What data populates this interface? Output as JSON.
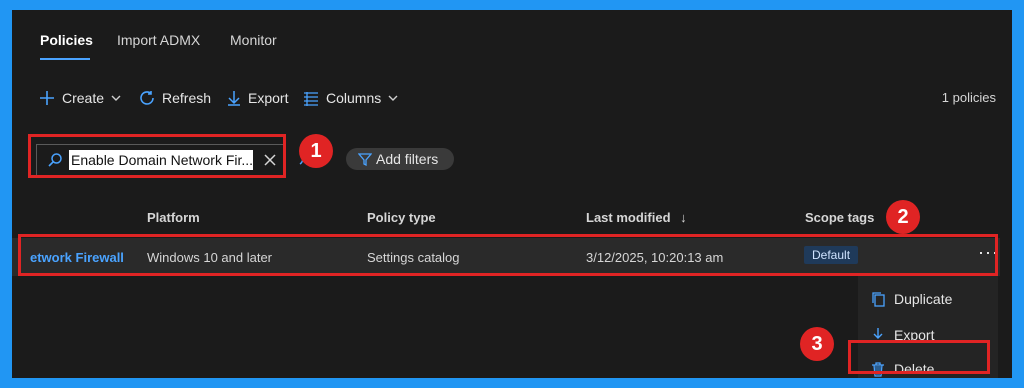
{
  "tabs": [
    {
      "label": "Policies",
      "active": true
    },
    {
      "label": "Import ADMX",
      "active": false
    },
    {
      "label": "Monitor",
      "active": false
    }
  ],
  "toolbar": {
    "create_label": "Create",
    "refresh_label": "Refresh",
    "export_label": "Export",
    "columns_label": "Columns",
    "count_text": "1 policies"
  },
  "search": {
    "value": "Enable Domain Network Fir..."
  },
  "filters": {
    "add_label": "Add filters"
  },
  "annotations": {
    "step1": "1",
    "step2": "2",
    "step3": "3"
  },
  "table": {
    "columns": [
      "Platform",
      "Policy type",
      "Last modified",
      "Scope tags"
    ],
    "sort_indicator": "↓",
    "rows": [
      {
        "name": "etwork Firewall",
        "platform": "Windows 10 and later",
        "policy_type": "Settings catalog",
        "last_modified": "3/12/2025, 10:20:13 am",
        "scope_tag": "Default",
        "more": "···"
      }
    ]
  },
  "context_menu": {
    "items": [
      "Duplicate",
      "Export",
      "Delete"
    ]
  },
  "colors": {
    "accent": "#4aa3ff",
    "annotation": "#e02424",
    "frame": "#2196f3",
    "background": "#1b1b1b"
  }
}
